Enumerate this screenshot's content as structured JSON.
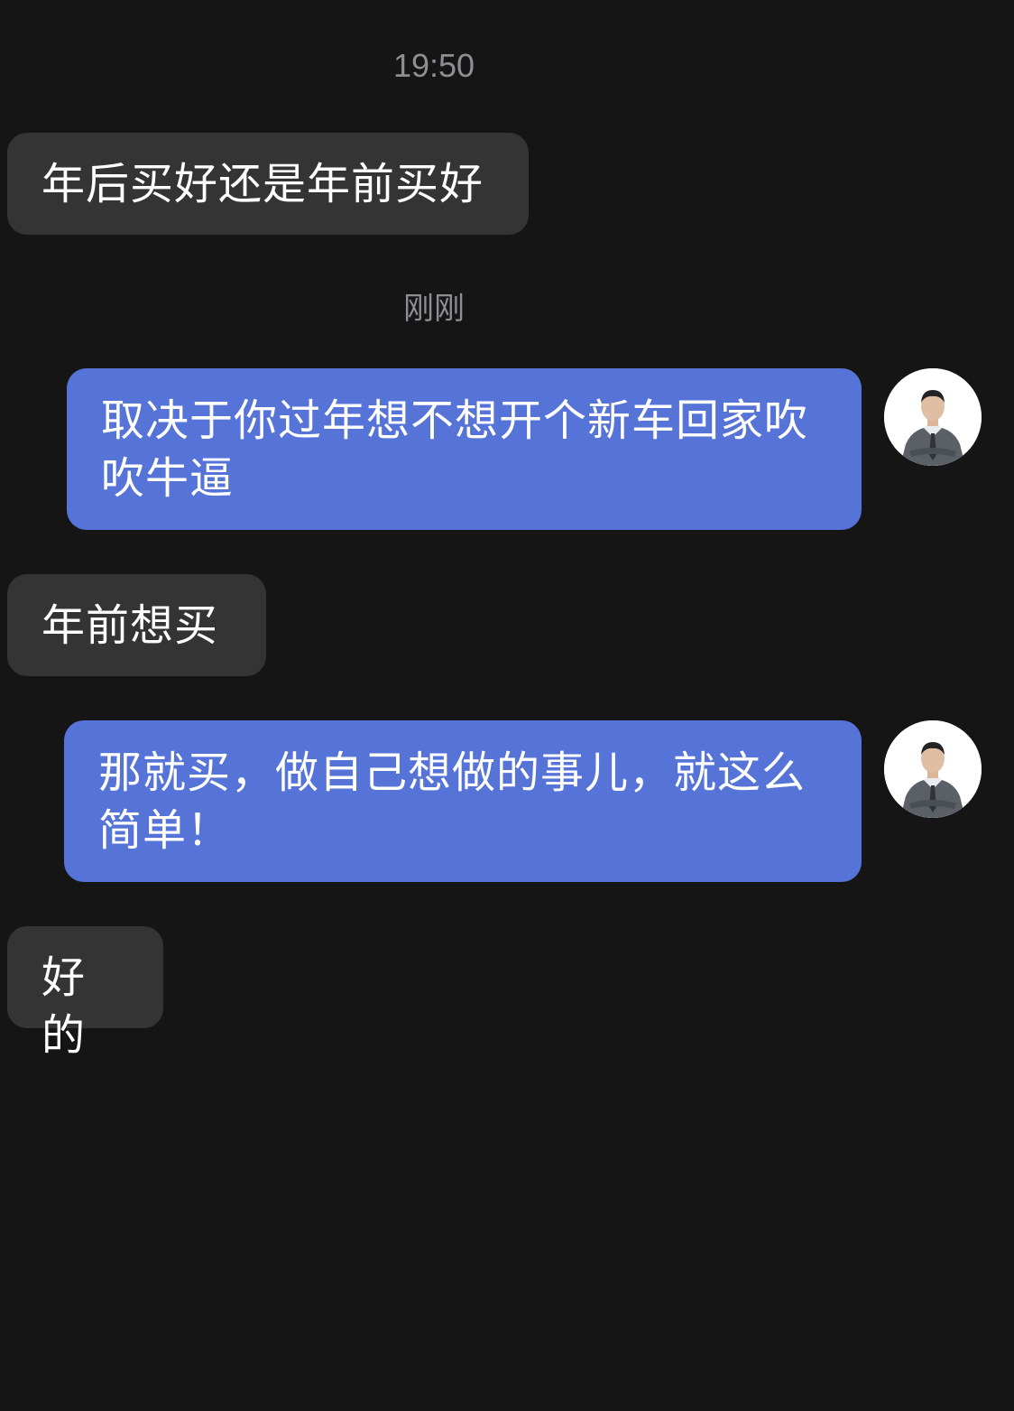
{
  "timestamps": [
    "19:50",
    "刚刚"
  ],
  "messages": [
    {
      "side": "incoming",
      "text": "年后买好还是年前买好"
    },
    {
      "side": "outgoing",
      "text": "取决于你过年想不想开个新车回家吹吹牛逼"
    },
    {
      "side": "incoming",
      "text": "年前想买"
    },
    {
      "side": "outgoing",
      "text": "那就买，做自己想做的事儿，就这么简单！"
    },
    {
      "side": "incoming",
      "text": "好的"
    }
  ],
  "colors": {
    "background": "#161516",
    "incoming_bubble": "#353435",
    "outgoing_bubble": "#5673d8",
    "timestamp": "#8e8e93"
  },
  "avatar": {
    "icon": "user-avatar-photo"
  }
}
